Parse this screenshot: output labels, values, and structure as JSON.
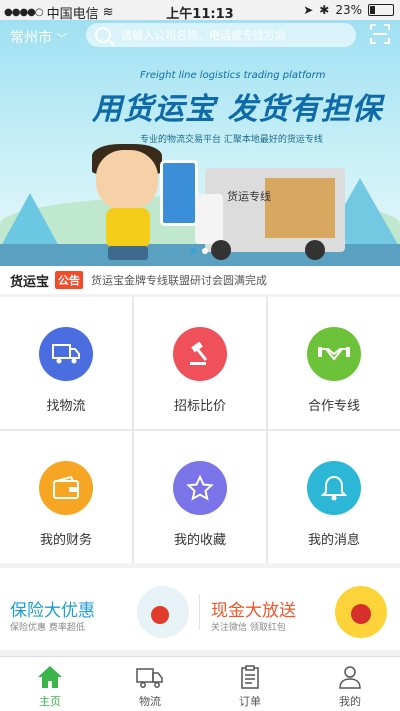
{
  "status_bar": {
    "carrier": "中国电信",
    "time": "上午11:13",
    "battery": "23%"
  },
  "header": {
    "city": "常州市",
    "search_placeholder": "请输入公司名称、电话或专线方向"
  },
  "banner": {
    "english_tagline": "Freight line logistics trading platform",
    "headline": "用货运宝 发货有担保",
    "subline": "专业的物流交易平台 汇聚本地最好的货运专线",
    "truck_label": "货运专线"
  },
  "notice": {
    "brand": "货运宝",
    "badge": "公告",
    "text": "货运宝金牌专线联盟研讨会圆满完成"
  },
  "grid": [
    {
      "label": "找物流",
      "icon": "truck-icon",
      "color": "#4a6ee0"
    },
    {
      "label": "招标比价",
      "icon": "gavel-icon",
      "color": "#f0505a"
    },
    {
      "label": "合作专线",
      "icon": "handshake-icon",
      "color": "#6cc33a"
    },
    {
      "label": "我的财务",
      "icon": "wallet-icon",
      "color": "#f6a623"
    },
    {
      "label": "我的收藏",
      "icon": "star-icon",
      "color": "#7a74e8"
    },
    {
      "label": "我的消息",
      "icon": "bell-icon",
      "color": "#2cb7d6"
    }
  ],
  "promos": [
    {
      "title": "保险大优惠",
      "subtitle": "保险优惠 费率超低"
    },
    {
      "title": "现金大放送",
      "subtitle": "关注微信 领取红包"
    }
  ],
  "tabbar": [
    {
      "label": "主页",
      "icon": "home-icon",
      "active": true
    },
    {
      "label": "物流",
      "icon": "truck-icon"
    },
    {
      "label": "订单",
      "icon": "clipboard-icon"
    },
    {
      "label": "我的",
      "icon": "user-icon"
    }
  ]
}
